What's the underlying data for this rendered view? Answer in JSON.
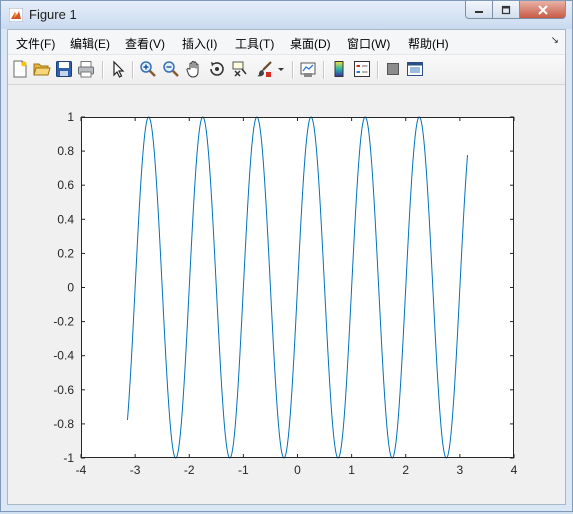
{
  "window": {
    "title": "Figure 1",
    "icons": {
      "app": "matlab-icon",
      "minimize": "minimize-icon",
      "maximize": "maximize-icon",
      "close": "close-icon"
    }
  },
  "menubar": {
    "items": [
      "文件(F)",
      "编辑(E)",
      "查看(V)",
      "插入(I)",
      "工具(T)",
      "桌面(D)",
      "窗口(W)",
      "帮助(H)"
    ],
    "overflow_icon": "dock-arrow-icon"
  },
  "toolbar": {
    "buttons": [
      "new-figure-icon",
      "open-file-icon",
      "save-icon",
      "print-icon",
      "edit-plot-icon",
      "zoom-in-icon",
      "zoom-out-icon",
      "pan-icon",
      "rotate-3d-icon",
      "data-cursor-icon",
      "brush-icon",
      "link-plot-icon",
      "colorbar-icon",
      "legend-icon",
      "hide-plot-tools-icon",
      "show-plot-tools-icon"
    ]
  },
  "colors": {
    "line": "#0072bd",
    "axes_bg": "#ffffff",
    "figure_bg": "#f0f0f0"
  },
  "chart_data": {
    "type": "line",
    "title": "",
    "xlabel": "",
    "ylabel": "",
    "xlim": [
      -4,
      4
    ],
    "ylim": [
      -1,
      1
    ],
    "xticks": [
      "-4",
      "-3",
      "-2",
      "-1",
      "0",
      "1",
      "2",
      "3",
      "4"
    ],
    "yticks": [
      "1",
      "0.8",
      "0.6",
      "0.4",
      "0.2",
      "0",
      "-0.2",
      "-0.4",
      "-0.6",
      "-0.8",
      "-1"
    ],
    "grid": false,
    "series": [
      {
        "function": "y = sin(2*pi*x)",
        "x_range": [
          -3.1416,
          3.1416
        ],
        "color": "#0072bd"
      }
    ]
  }
}
